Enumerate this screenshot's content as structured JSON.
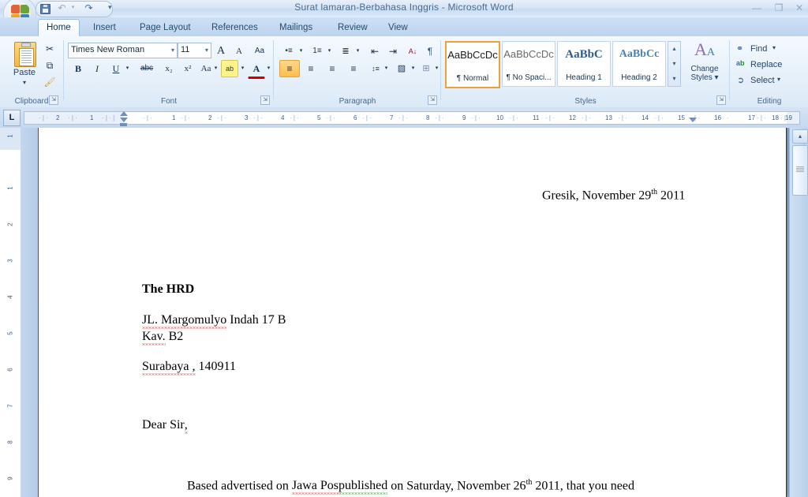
{
  "window": {
    "title": "Surat lamaran-Berbahasa Inggris  -  Microsoft Word",
    "minimize": "—",
    "restore": "❐",
    "close": "✕"
  },
  "quick_access": {
    "office_button": "office-orb",
    "save": "save-icon",
    "undo": "↶",
    "undo_dropdown": "▾",
    "redo": "↷",
    "customize": "▾"
  },
  "tabs": [
    {
      "label": "Home",
      "active": true
    },
    {
      "label": "Insert",
      "active": false
    },
    {
      "label": "Page Layout",
      "active": false
    },
    {
      "label": "References",
      "active": false
    },
    {
      "label": "Mailings",
      "active": false
    },
    {
      "label": "Review",
      "active": false
    },
    {
      "label": "View",
      "active": false
    }
  ],
  "ribbon": {
    "clipboard": {
      "label": "Clipboard",
      "paste": "Paste",
      "paste_arrow": "▾",
      "cut": "✂",
      "copy": "⧉",
      "format_painter": "🖌",
      "dialog_launcher": "⇲"
    },
    "font": {
      "label": "Font",
      "font_name": "Times New Roman",
      "font_size": "11",
      "dropdown_arrow": "▾",
      "grow_font": "A",
      "shrink_font": "A",
      "clear_formatting": "Aa",
      "bold": "B",
      "italic": "I",
      "underline": "U",
      "strikethrough": "abc",
      "subscript": "x₂",
      "superscript": "x²",
      "change_case": "Aa",
      "highlight": "ab",
      "font_color": "A",
      "dialog_launcher": "⇲"
    },
    "paragraph": {
      "label": "Paragraph",
      "bullets": "•≡",
      "numbering": "1≡",
      "multilevel": "≣",
      "decrease_indent": "⇤",
      "increase_indent": "⇥",
      "sort": "A↓",
      "show_marks": "¶",
      "align_left": "≡",
      "align_center": "≡",
      "align_right": "≡",
      "justify": "≡",
      "line_spacing": "↕≡",
      "shading": "▨",
      "borders": "⊞",
      "dialog_launcher": "⇲"
    },
    "styles": {
      "label": "Styles",
      "gallery": [
        {
          "preview": "AaBbCcDc",
          "name": "¶ Normal",
          "selected": true,
          "heading": false
        },
        {
          "preview": "AaBbCcDc",
          "name": "¶ No Spaci...",
          "selected": false,
          "heading": false
        },
        {
          "preview": "AaBbC",
          "name": "Heading 1",
          "selected": false,
          "heading": true
        },
        {
          "preview": "AaBbCc",
          "name": "Heading 2",
          "selected": false,
          "heading": true
        }
      ],
      "scroll_up": "▴",
      "scroll_down": "▾",
      "more": "▾",
      "change_styles": "Change",
      "change_styles_2": "Styles ▾",
      "dialog_launcher": "⇲"
    },
    "editing": {
      "label": "Editing",
      "find": "Find",
      "find_arrow": "▾",
      "replace": "Replace",
      "select": "Select",
      "select_arrow": "▾",
      "find_icon": "binoculars-icon",
      "replace_icon": "replace-icon",
      "select_icon": "cursor-icon"
    }
  },
  "ruler": {
    "tab_selector": "L",
    "horizontal_left": [
      "2",
      "1"
    ],
    "horizontal_right": [
      "1",
      "2",
      "3",
      "4",
      "5",
      "6",
      "7",
      "8",
      "9",
      "10",
      "11",
      "12",
      "13",
      "14",
      "15",
      "16",
      "17",
      "18",
      "19"
    ],
    "vertical": [
      "1",
      "1",
      "2",
      "3",
      "4",
      "5",
      "6",
      "7",
      "8",
      "9"
    ]
  },
  "document": {
    "date_line": {
      "prefix": "Gresik, November 29",
      "sup": "th",
      "suffix": " 2011"
    },
    "recipient": "The HRD",
    "address_line1_a": "JL. Margomulyo",
    "address_line1_b": " Indah 17 B",
    "address_line2_a": "Kav.",
    "address_line2_b": " B2",
    "address_line3_a": "Surabaya ,",
    "address_line3_b": " 140911",
    "salutation_a": "Dear Sir",
    "salutation_b": ",",
    "body_1": "Based advertised on ",
    "body_2": "Jawa Pos",
    "body_3": " published",
    "body_4": " on Saturday, November 26",
    "body_sup": "th",
    "body_5": " 2011, that you need"
  },
  "scrollbar": {
    "up_arrow": "▴",
    "down_arrow": "▾",
    "prev_page": "⇧",
    "select_object": "◎",
    "next_page": "⇩"
  }
}
